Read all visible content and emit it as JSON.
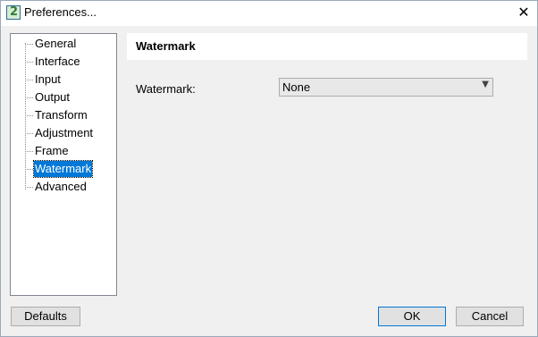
{
  "window": {
    "title": "Preferences..."
  },
  "app_icon": {
    "glyph": "2",
    "name": "app-icon"
  },
  "close_icon": "✕",
  "tree": {
    "items": [
      {
        "label": "General"
      },
      {
        "label": "Interface"
      },
      {
        "label": "Input"
      },
      {
        "label": "Output"
      },
      {
        "label": "Transform"
      },
      {
        "label": "Adjustment"
      },
      {
        "label": "Frame"
      },
      {
        "label": "Watermark",
        "selected": true
      },
      {
        "label": "Advanced"
      }
    ]
  },
  "panel": {
    "title": "Watermark",
    "watermark_label": "Watermark:",
    "watermark_value": "None",
    "dropdown_icon": "chevron-down-icon"
  },
  "buttons": {
    "defaults": "Defaults",
    "ok": "OK",
    "cancel": "Cancel"
  },
  "colors": {
    "selection": "#0078d7",
    "window_bg": "#f0f0f0"
  }
}
